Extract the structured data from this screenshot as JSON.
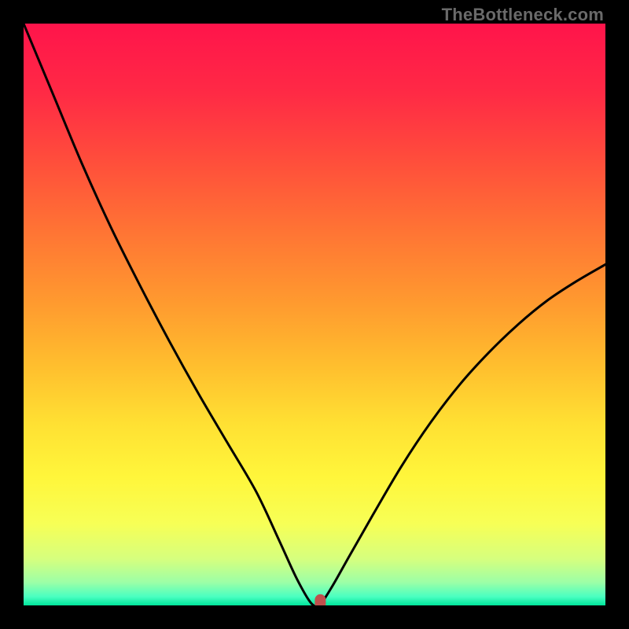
{
  "watermark": "TheBottleneck.com",
  "chart_data": {
    "type": "line",
    "title": "",
    "xlabel": "",
    "ylabel": "",
    "xlim": [
      0,
      100
    ],
    "ylim": [
      0,
      100
    ],
    "series": [
      {
        "name": "curve",
        "x": [
          0,
          5,
          10,
          15,
          20,
          25,
          30,
          35,
          40,
          44,
          47,
          49.5,
          51,
          53,
          56,
          60,
          65,
          70,
          75,
          80,
          85,
          90,
          95,
          100
        ],
        "y": [
          100,
          88,
          76,
          65,
          55,
          45.5,
          36.5,
          28,
          19.5,
          11,
          4.5,
          0.3,
          0.3,
          3.2,
          8.5,
          15.5,
          24,
          31.5,
          38,
          43.5,
          48.3,
          52.4,
          55.7,
          58.6
        ]
      }
    ],
    "marker": {
      "x": 51,
      "y": 0.5
    },
    "gradient_stops": [
      {
        "offset": 0.0,
        "color": "#ff144b"
      },
      {
        "offset": 0.12,
        "color": "#ff2a45"
      },
      {
        "offset": 0.24,
        "color": "#ff4f3b"
      },
      {
        "offset": 0.36,
        "color": "#ff7534"
      },
      {
        "offset": 0.48,
        "color": "#ff9a2f"
      },
      {
        "offset": 0.59,
        "color": "#ffbf2e"
      },
      {
        "offset": 0.69,
        "color": "#ffe133"
      },
      {
        "offset": 0.78,
        "color": "#fff63b"
      },
      {
        "offset": 0.86,
        "color": "#f7ff56"
      },
      {
        "offset": 0.92,
        "color": "#d6ff7e"
      },
      {
        "offset": 0.96,
        "color": "#9dffa6"
      },
      {
        "offset": 0.985,
        "color": "#4affc1"
      },
      {
        "offset": 1.0,
        "color": "#00e59b"
      }
    ],
    "curve_color": "#000000",
    "marker_color": "#c0504d"
  }
}
